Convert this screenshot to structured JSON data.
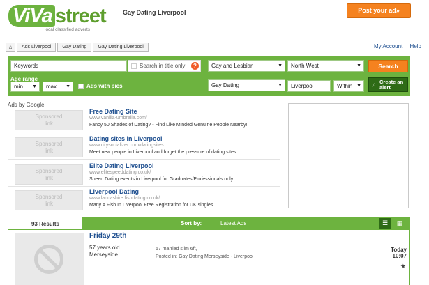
{
  "header": {
    "logo_viva": "ViVa",
    "logo_street": "street",
    "logo_tagline": "local classified adverts",
    "page_title": "Gay Dating Liverpool",
    "post_ad_label": "Post your ad»"
  },
  "breadcrumb": {
    "home_icon": "home-icon",
    "items": [
      "Ads Liverpool",
      "Gay Dating",
      "Gay Dating Liverpool"
    ]
  },
  "top_links": {
    "account": "My Account",
    "help": "Help"
  },
  "search": {
    "keywords_placeholder": "Keywords",
    "title_only_label": "Search in title only",
    "help_glyph": "?",
    "category_value": "Gay and Lesbian",
    "region_value": "North West",
    "search_button": "Search",
    "age_range_label": "Age range",
    "age_min": "min",
    "age_max": "max",
    "with_pics_label": "Ads with pics",
    "subcategory_value": "Gay Dating",
    "location_value": "Liverpool",
    "within_value": "Within",
    "alert_line1": "Create an",
    "alert_line2": "alert"
  },
  "ads": {
    "ads_by_label": "Ads by Google",
    "sponsored_line1": "Sponsored",
    "sponsored_line2": "link",
    "items": [
      {
        "title": "Free Dating Site",
        "url": "www.vanilla-umbrella.com/",
        "desc": "Fancy 50 Shades of Dating? - Find Like Minded Genuine People Nearby!"
      },
      {
        "title": "Dating sites in Liverpool",
        "url": "www.citysocializer.com/datingsites",
        "desc": "Meet new people in Liverpool and forget the pressure of dating sites"
      },
      {
        "title": "Elite Dating Liverpool",
        "url": "www.elitespeeddating.co.uk/",
        "desc": "Speed Dating events in Liverpool for Graduates/Professionals only"
      },
      {
        "title": "Liverpool Dating",
        "url": "www.lancashire.fishdating.co.uk/",
        "desc": "Many A Fish In Liverpool Free Registration for UK singles"
      }
    ]
  },
  "results": {
    "count_label": "93 Results",
    "sort_by_label": "Sort by:",
    "sort_value": "Latest Ads",
    "list_view_icon": "list-view-icon",
    "grid_view_icon": "grid-view-icon"
  },
  "listing": {
    "date": "Friday 29th",
    "age": "57 years old",
    "location": "Merseyside",
    "description": "57 married slim 6ft,",
    "posted_in": "Posted in:  Gay Dating Merseyside - Liverpool",
    "day": "Today",
    "time": "10:07",
    "photo_icon": "no-photo-icon",
    "star_icon": "star-icon"
  },
  "colors": {
    "brand_green": "#6db33f",
    "dark_green": "#2e6b16",
    "accent_orange": "#f5821f",
    "link_blue": "#1d4e8f"
  }
}
